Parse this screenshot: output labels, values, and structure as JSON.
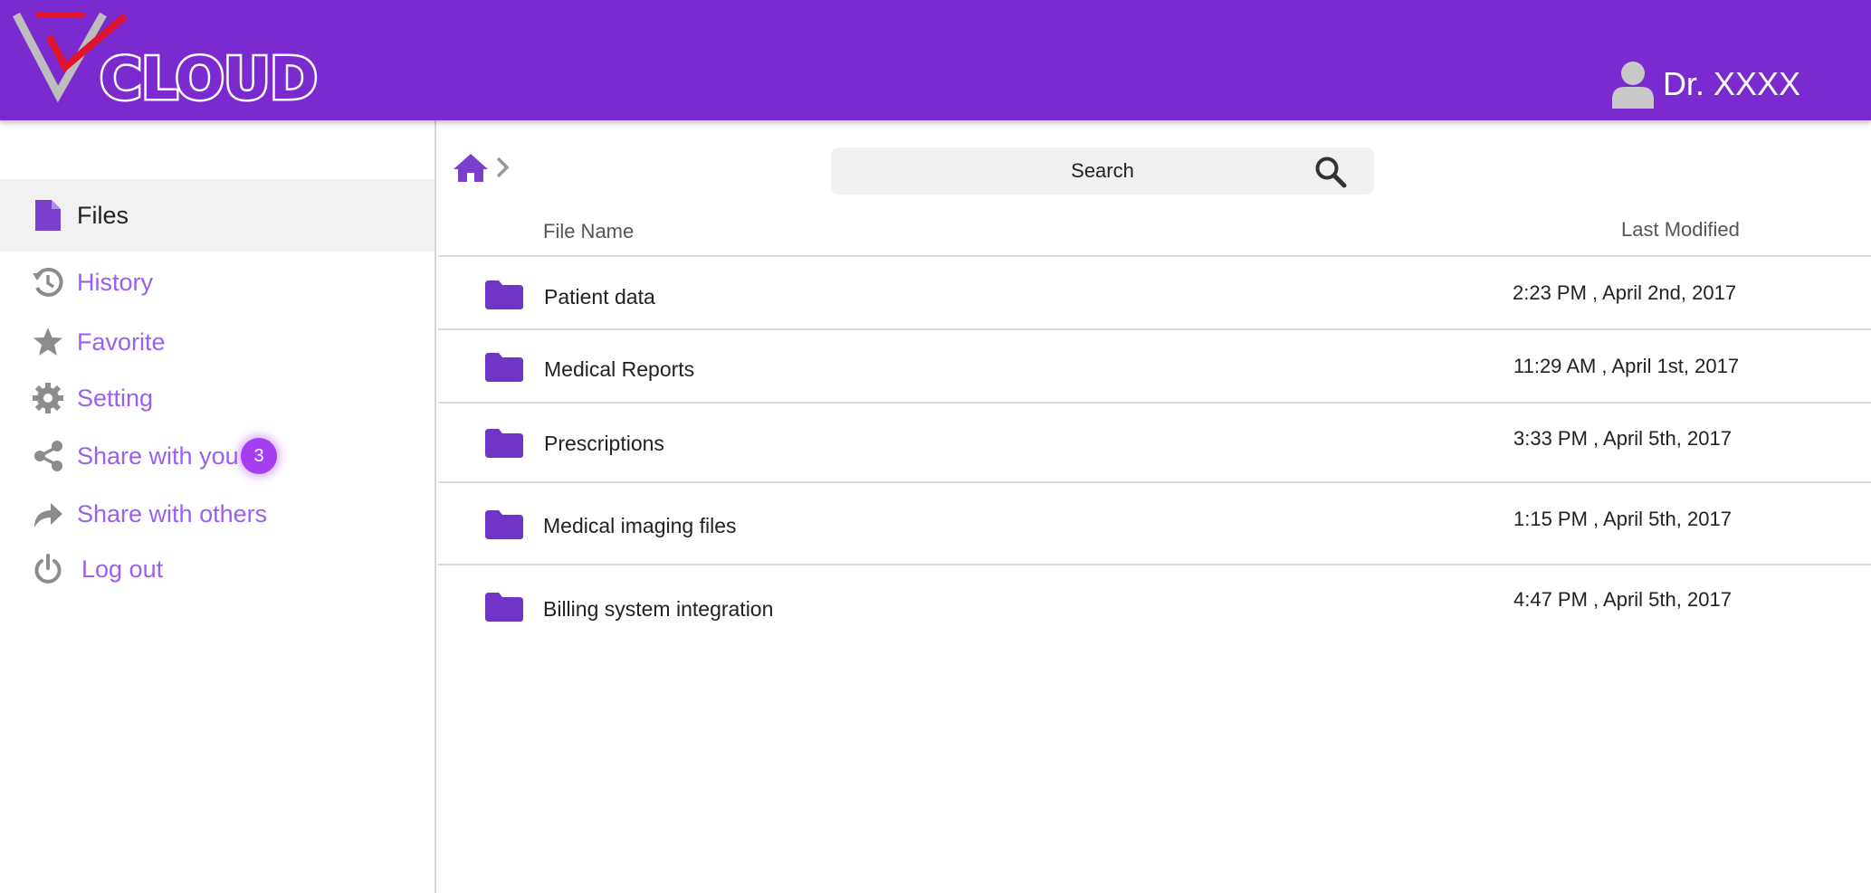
{
  "brand": {
    "logo_text": "CLOUD",
    "logo_mark": "V"
  },
  "user": {
    "name": "Dr. XXXX",
    "icon": "user-icon"
  },
  "sidebar": {
    "items": [
      {
        "label": "Files",
        "icon": "file-icon",
        "active": true
      },
      {
        "label": "History",
        "icon": "history-icon"
      },
      {
        "label": "Favorite",
        "icon": "star-icon"
      },
      {
        "label": "Setting",
        "icon": "gear-icon"
      },
      {
        "label": "Share with you",
        "icon": "share-icon",
        "badge": "3"
      },
      {
        "label": "Share with others",
        "icon": "forward-icon"
      },
      {
        "label": "Log out",
        "icon": "power-icon"
      }
    ]
  },
  "toolbar": {
    "search_label": "Search"
  },
  "table": {
    "headers": {
      "name": "File Name",
      "modified": "Last Modified"
    },
    "rows": [
      {
        "name": "Patient data",
        "modified": "2:23 PM , April 2nd, 2017"
      },
      {
        "name": "Medical Reports",
        "modified": "11:29 AM , April 1st, 2017"
      },
      {
        "name": "Prescriptions",
        "modified": "3:33 PM , April 5th, 2017"
      },
      {
        "name": "Medical imaging files",
        "modified": "1:15 PM , April 5th, 2017"
      },
      {
        "name": "Billing system integration",
        "modified": "4:47 PM , April 5th, 2017"
      }
    ]
  },
  "colors": {
    "brand": "#7a2ace",
    "accent": "#9b5ff0",
    "folder": "#6f35c7",
    "badge": "#a63ff0",
    "icon_gray": "#8c8c8c"
  }
}
